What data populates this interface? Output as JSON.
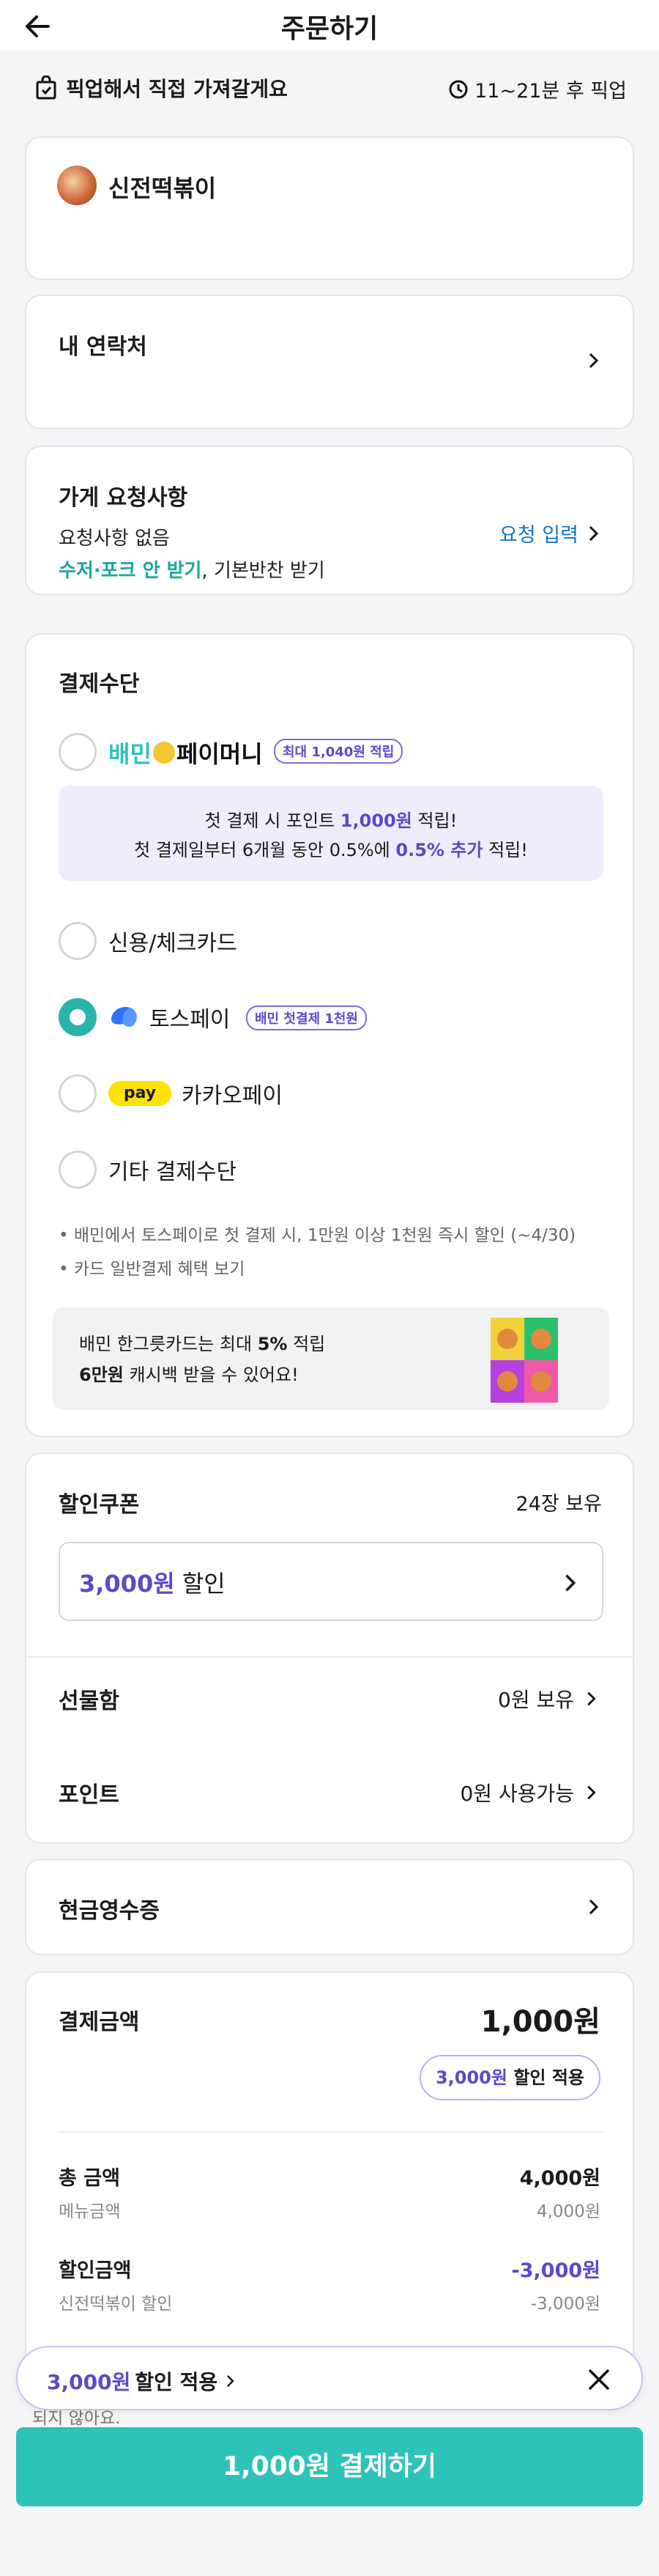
{
  "header": {
    "title": "주문하기"
  },
  "pickup": {
    "label": "픽업해서 직접 가져갈게요",
    "time": "11~21분 후 픽업"
  },
  "store": {
    "name": "신전떡볶이"
  },
  "contact": {
    "title": "내 연락처"
  },
  "request": {
    "title": "가게 요청사항",
    "value": "요청사항 없음",
    "option_highlight": "수저·포크 안 받기",
    "option_rest": ", 기본반찬 받기",
    "action": "요청 입력"
  },
  "payment": {
    "title": "결제수단",
    "baemin_pay": {
      "label_a": "배민",
      "label_b": "페이머니",
      "badge": "최대 1,040원 적립"
    },
    "promo": {
      "l1_a": "첫 결제 시 포인트 ",
      "l1_b": "1,000원",
      "l1_c": " 적립!",
      "l2_a": "첫 결제일부터 6개월 동안 0.5%에 ",
      "l2_b": "0.5% 추가",
      "l2_c": " 적립!"
    },
    "options": {
      "card": "신용/체크카드",
      "toss": "토스페이",
      "toss_badge": "배민 첫결제 1천원",
      "kakao_logo": "pay",
      "kakao": "카카오페이",
      "other": "기타 결제수단"
    },
    "selected": "toss",
    "notes": [
      "• 배민에서 토스페이로 첫 결제 시, 1만원 이상 1천원 즉시 할인 (~4/30)",
      "• 카드 일반결제 혜택 보기"
    ],
    "banner": {
      "l1_a": "배민 한그릇카드는 최대 ",
      "l1_b": "5%",
      "l1_c": " 적립",
      "l2_a": "6만원",
      "l2_b": " 캐시백 받을 수 있어요!"
    }
  },
  "discount": {
    "coupon_title": "할인쿠폰",
    "coupon_count": "24장 보유",
    "coupon_amount": "3,000원",
    "coupon_suffix": " 할인",
    "gift_title": "선물함",
    "gift_value": "0원 보유",
    "point_title": "포인트",
    "point_value": "0원 사용가능"
  },
  "receipt": {
    "title": "현금영수증"
  },
  "amount": {
    "title": "결제금액",
    "total": "1,000원",
    "applied_amount": "3,000원",
    "applied_suffix": " 할인 적용",
    "sum_label": "총 금액",
    "sum_value": "4,000원",
    "menu_label": "메뉴금액",
    "menu_value": "4,000원",
    "disc_label": "할인금액",
    "disc_value": "-3,000원",
    "store_disc_label": "신전떡볶이 할인",
    "store_disc_value": "-3,000원",
    "footnote": "되지 않아요."
  },
  "float": {
    "amount": "3,000원",
    "suffix": " 할인 적용"
  },
  "cta": {
    "label": "1,000원 결제하기"
  },
  "colors": {
    "teal": "#2ec3b8",
    "purple": "#5b49c9",
    "blue": "#1973c8"
  }
}
